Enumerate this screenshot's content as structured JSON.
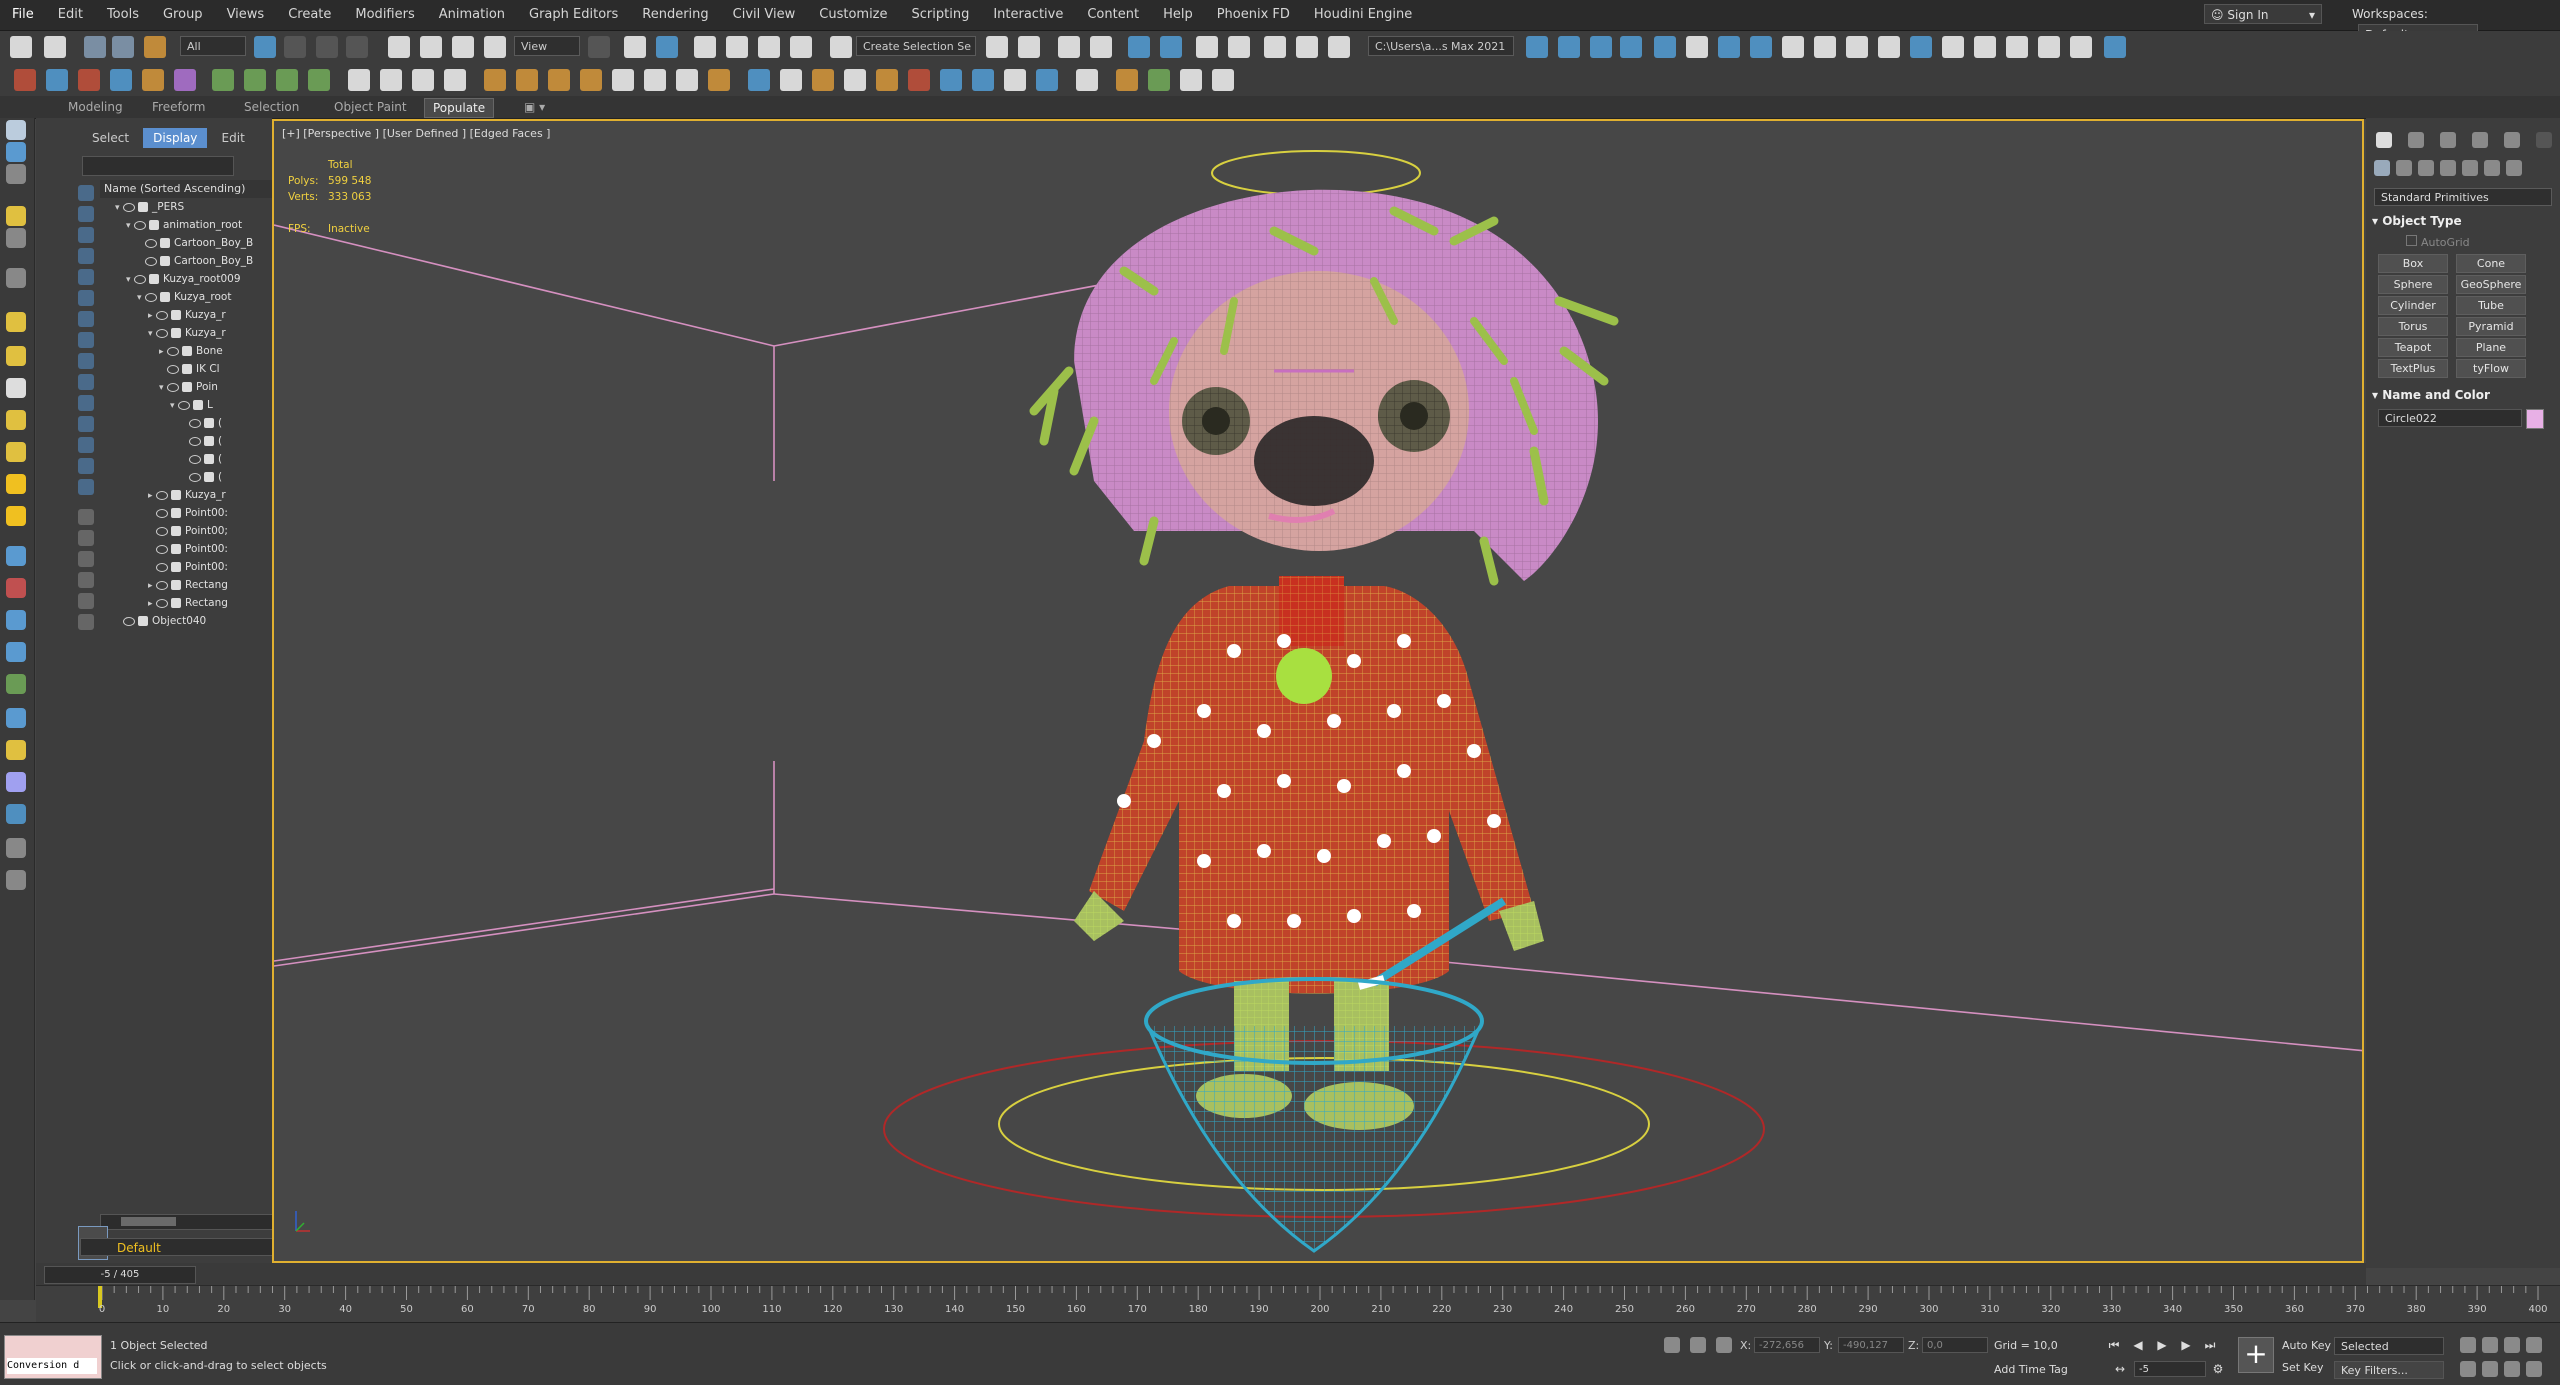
{
  "menubar": {
    "items": [
      "File",
      "Edit",
      "Tools",
      "Group",
      "Views",
      "Create",
      "Modifiers",
      "Animation",
      "Graph Editors",
      "Rendering",
      "Civil View",
      "Customize",
      "Scripting",
      "Interactive",
      "Content",
      "Help",
      "Phoenix FD",
      "Houdini Engine"
    ],
    "sign_in": "Sign In",
    "workspaces_label": "Workspaces:",
    "workspaces_value": "Default"
  },
  "toolbar1": {
    "filter_value": "All",
    "refcoord_value": "View",
    "selection_set": "Create Selection Se",
    "path_value": "C:\\Users\\a...s Max 2021"
  },
  "ribbon": {
    "tabs": [
      "Modeling",
      "Freeform",
      "Selection",
      "Object Paint",
      "Populate"
    ]
  },
  "explorer": {
    "tabs": [
      "Select",
      "Display",
      "Edit"
    ],
    "header": "Name (Sorted Ascending)",
    "rows": [
      {
        "label": "_PERS"
      },
      {
        "label": "animation_root"
      },
      {
        "label": "Cartoon_Boy_B"
      },
      {
        "label": "Cartoon_Boy_B"
      },
      {
        "label": "Kuzya_root009"
      },
      {
        "label": "Kuzya_root"
      },
      {
        "label": "Kuzya_r"
      },
      {
        "label": "Kuzya_r"
      },
      {
        "label": "Bone"
      },
      {
        "label": "IK Cl"
      },
      {
        "label": "Poin"
      },
      {
        "label": "L"
      },
      {
        "label": "("
      },
      {
        "label": "("
      },
      {
        "label": "("
      },
      {
        "label": "("
      },
      {
        "label": "Kuzya_r"
      },
      {
        "label": "Point00:"
      },
      {
        "label": "Point00;"
      },
      {
        "label": "Point00:"
      },
      {
        "label": "Point00:"
      },
      {
        "label": "Rectang"
      },
      {
        "label": "Rectang"
      },
      {
        "label": "Object040"
      }
    ],
    "layer": "Default"
  },
  "viewport": {
    "label": "[+] [Perspective ] [User Defined ] [Edged Faces ]",
    "stats_title": "Total",
    "polys_label": "Polys:",
    "polys_value": "599 548",
    "verts_label": "Verts:",
    "verts_value": "333 063",
    "fps_label": "FPS:",
    "fps_value": "Inactive"
  },
  "command_panel": {
    "dropdown": "Standard Primitives",
    "object_type_title": "Object Type",
    "autogrid": "AutoGrid",
    "buttons": [
      "Box",
      "Cone",
      "Sphere",
      "GeoSphere",
      "Cylinder",
      "Tube",
      "Torus",
      "Pyramid",
      "Teapot",
      "Plane",
      "TextPlus",
      "tyFlow"
    ],
    "name_color_title": "Name and Color",
    "object_name": "Circle022",
    "object_color": "#e8b0e6"
  },
  "timeline": {
    "slider_value": "-5 / 405",
    "tick_labels": [
      "0",
      "10",
      "20",
      "30",
      "40",
      "50",
      "60",
      "70",
      "80",
      "90",
      "100",
      "110",
      "120",
      "130",
      "140",
      "150",
      "160",
      "170",
      "180",
      "190",
      "200",
      "210",
      "220",
      "230",
      "240",
      "250",
      "260",
      "270",
      "280",
      "290",
      "300",
      "310",
      "320",
      "330",
      "340",
      "350",
      "360",
      "370",
      "380",
      "390",
      "400"
    ]
  },
  "statusbar": {
    "maxscript_output": "Conversion d",
    "selection_status": "1 Object Selected",
    "prompt": "Click or click-and-drag to select objects",
    "x_label": "X:",
    "x_value": "-272,656",
    "y_label": "Y:",
    "y_value": "-490,127",
    "z_label": "Z:",
    "z_value": "0,0",
    "grid": "Grid = 10,0",
    "add_time_tag": "Add Time Tag",
    "auto_key": "Auto Key",
    "set_key": "Set Key",
    "selected_value": "Selected",
    "key_filters": "Key Filters...",
    "frame_value": "-5"
  }
}
